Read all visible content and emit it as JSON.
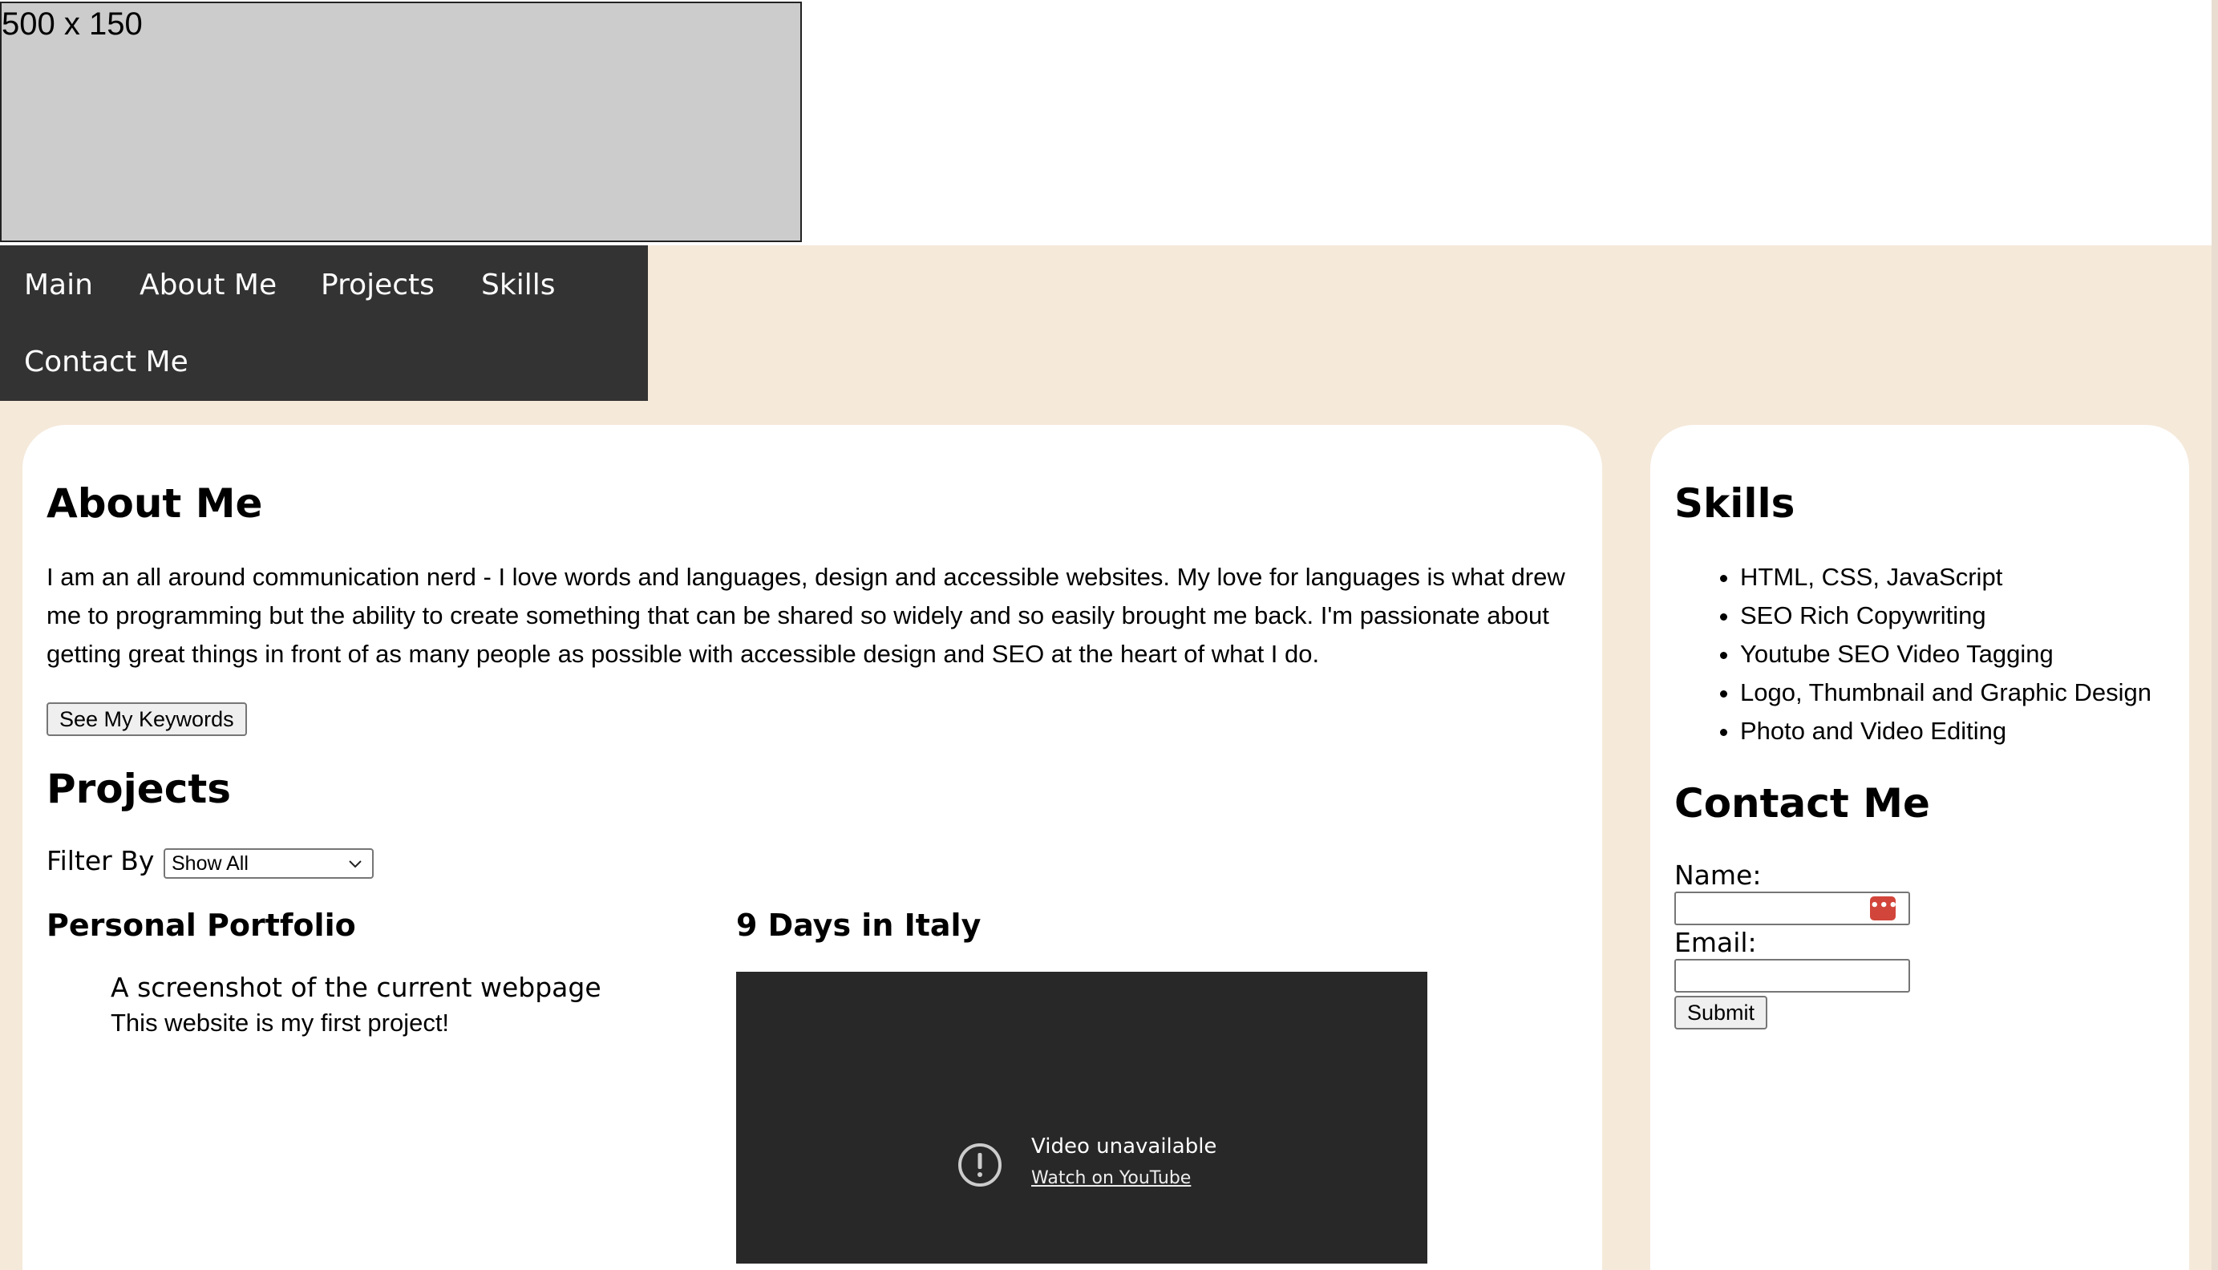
{
  "banner": {
    "placeholder_text": "500 x 150"
  },
  "nav": {
    "items": [
      {
        "label": "Main"
      },
      {
        "label": "About Me"
      },
      {
        "label": "Projects"
      },
      {
        "label": "Skills"
      },
      {
        "label": "Contact Me"
      }
    ]
  },
  "about": {
    "heading": "About Me",
    "text": "I am an all around communication nerd - I love words and languages, design and accessible websites. My love for languages is what drew me to programming but the ability to create something that can be shared so widely and so easily brought me back. I'm passionate about getting great things in front of as many people as possible with accessible design and SEO at the heart of what I do.",
    "button_label": "See My Keywords"
  },
  "projects": {
    "heading": "Projects",
    "filter_label": "Filter By",
    "filter_selected": "Show All",
    "items": [
      {
        "title": "Personal Portfolio",
        "image_alt": "A screenshot of the current webpage",
        "caption": "This website is my first project!"
      },
      {
        "title": "9 Days in Italy",
        "video_status": "Video unavailable",
        "video_link": "Watch on YouTube"
      }
    ]
  },
  "skills": {
    "heading": "Skills",
    "items": [
      "HTML, CSS, JavaScript",
      "SEO Rich Copywriting",
      "Youtube SEO Video Tagging",
      "Logo, Thumbnail and Graphic Design",
      "Photo and Video Editing"
    ]
  },
  "contact": {
    "heading": "Contact Me",
    "name_label": "Name:",
    "email_label": "Email:",
    "name_value": "",
    "email_value": "",
    "submit_label": "Submit"
  },
  "colors": {
    "page_background": "#f5e9da",
    "nav_background": "#333333",
    "card_background": "#ffffff",
    "banner_placeholder": "#cccccc",
    "video_background": "#282828",
    "autofill_icon": "#d2453b"
  },
  "icons": {
    "select_chevron": "chevron-down-icon",
    "video_error": "exclamation-circle-icon",
    "autofill": "password-manager-icon"
  }
}
